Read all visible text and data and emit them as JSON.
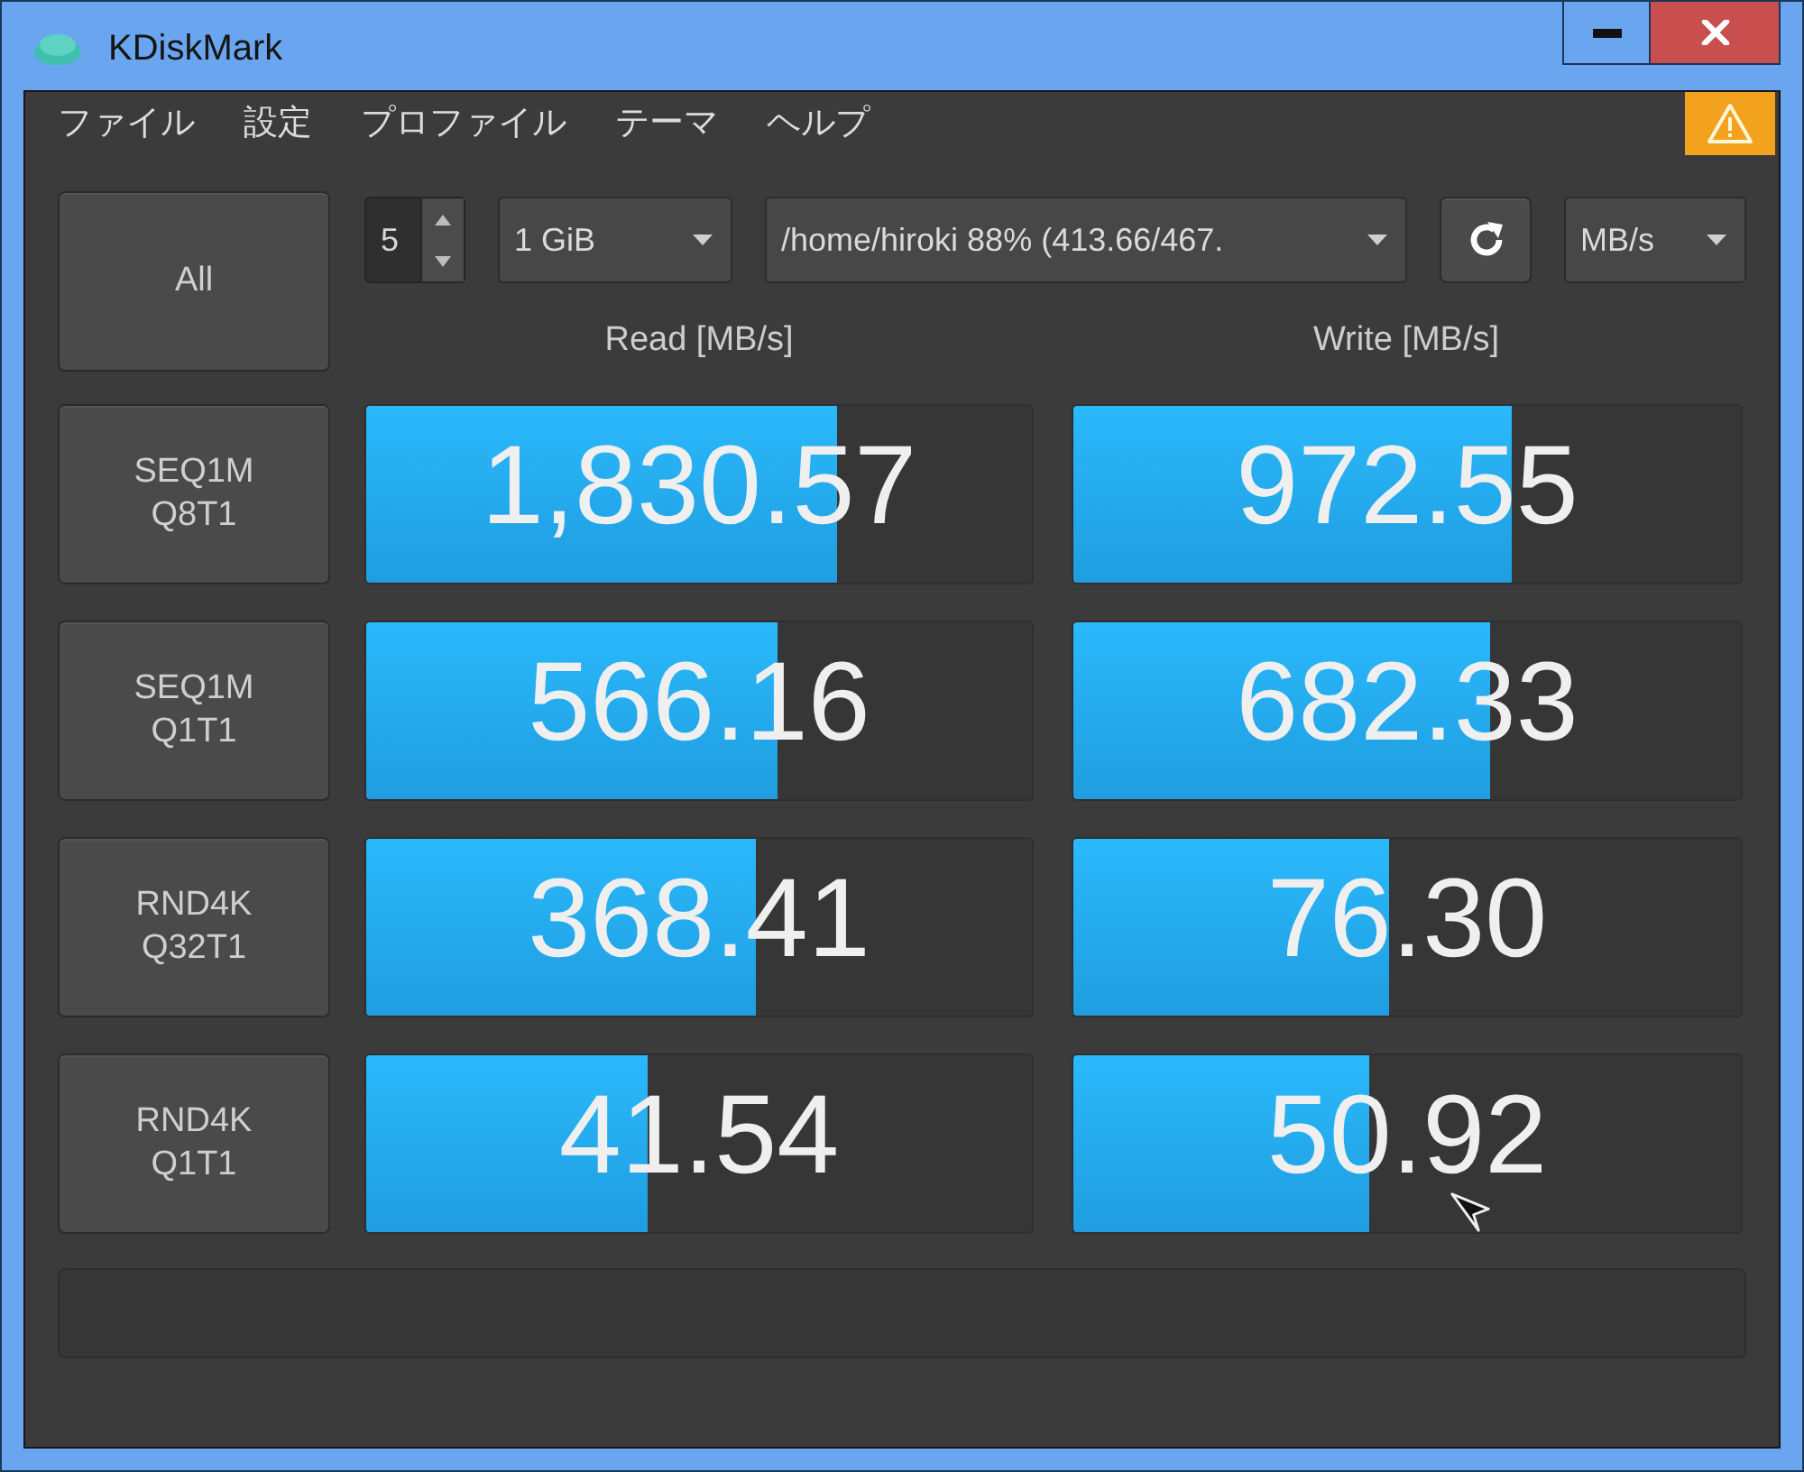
{
  "window": {
    "title": "KDiskMark"
  },
  "menu": [
    "ファイル",
    "設定",
    "プロファイル",
    "テーマ",
    "ヘルプ"
  ],
  "toolbar": {
    "all_button": "All",
    "runs": "5",
    "size": "1 GiB",
    "target": "/home/hiroki 88% (413.66/467.",
    "units": "MB/s"
  },
  "columns": [
    "Read [MB/s]",
    "Write [MB/s]"
  ],
  "tests": [
    {
      "name": "SEQ1M",
      "params": "Q8T1",
      "read": {
        "value": "1,830.57",
        "level": 0.706
      },
      "write": {
        "value": "972.55",
        "level": 0.656
      }
    },
    {
      "name": "SEQ1M",
      "params": "Q1T1",
      "read": {
        "value": "566.16",
        "level": 0.617
      },
      "write": {
        "value": "682.33",
        "level": 0.624
      }
    },
    {
      "name": "RND4K",
      "params": "Q32T1",
      "read": {
        "value": "368.41",
        "level": 0.585
      },
      "write": {
        "value": "76.30",
        "level": 0.473
      }
    },
    {
      "name": "RND4K",
      "params": "Q1T1",
      "read": {
        "value": "41.54",
        "level": 0.423
      },
      "write": {
        "value": "50.92",
        "level": 0.444
      }
    }
  ]
}
